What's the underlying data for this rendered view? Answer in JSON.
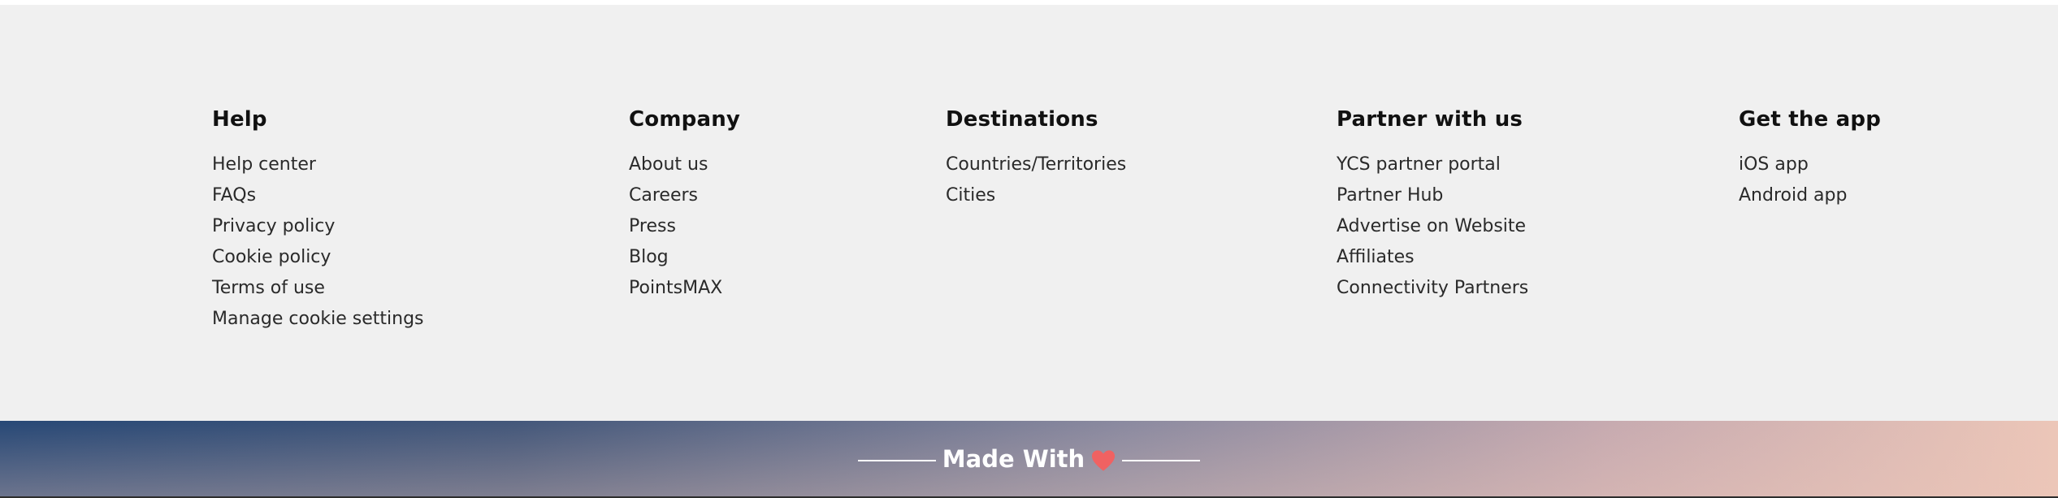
{
  "footer": {
    "columns": [
      {
        "heading": "Help",
        "links": [
          "Help center",
          "FAQs",
          "Privacy policy",
          "Cookie policy",
          "Terms of use",
          "Manage cookie settings"
        ]
      },
      {
        "heading": "Company",
        "links": [
          "About us",
          "Careers",
          "Press",
          "Blog",
          "PointsMAX"
        ]
      },
      {
        "heading": "Destinations",
        "links": [
          "Countries/Territories",
          "Cities"
        ]
      },
      {
        "heading": "Partner with us",
        "links": [
          "YCS partner portal",
          "Partner Hub",
          "Advertise on Website",
          "Affiliates",
          "Connectivity Partners"
        ]
      },
      {
        "heading": "Get the app",
        "links": [
          "iOS app",
          "Android app"
        ]
      }
    ]
  },
  "banner": {
    "text": "Made With",
    "icon": "heart-icon",
    "heart_color": "#f06262"
  },
  "colors": {
    "footer_bg": "#f0f0f0",
    "banner_gradient_start": "#274876",
    "banner_gradient_end": "#ecc6b8"
  }
}
